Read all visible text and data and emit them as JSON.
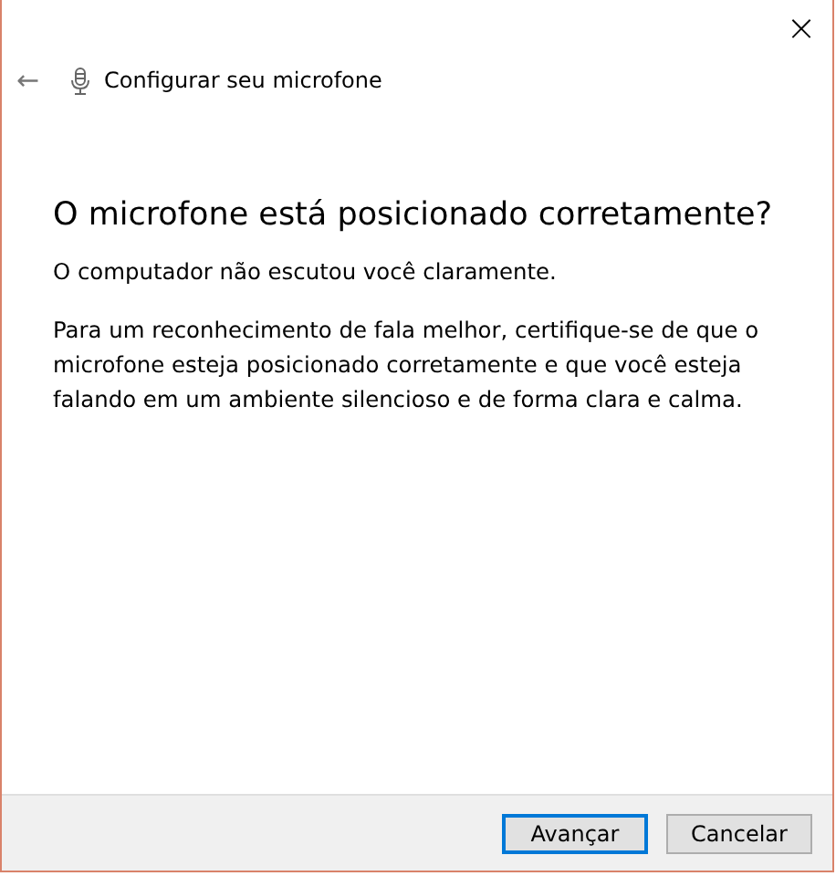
{
  "window": {
    "close": "×"
  },
  "header": {
    "back": "←",
    "title": "Configurar seu microfone"
  },
  "heading": "O microfone está posicionado corretamente?",
  "paragraphs": [
    "O computador não escutou você claramente.",
    "Para um reconhecimento de fala melhor, certifique-se de que o microfone esteja posicionado corretamente e que você esteja falando em um ambiente silencioso e de forma clara e calma."
  ],
  "buttons": [
    {
      "label": "Avançar",
      "focused": true
    },
    {
      "label": "Cancelar",
      "focused": false
    }
  ]
}
